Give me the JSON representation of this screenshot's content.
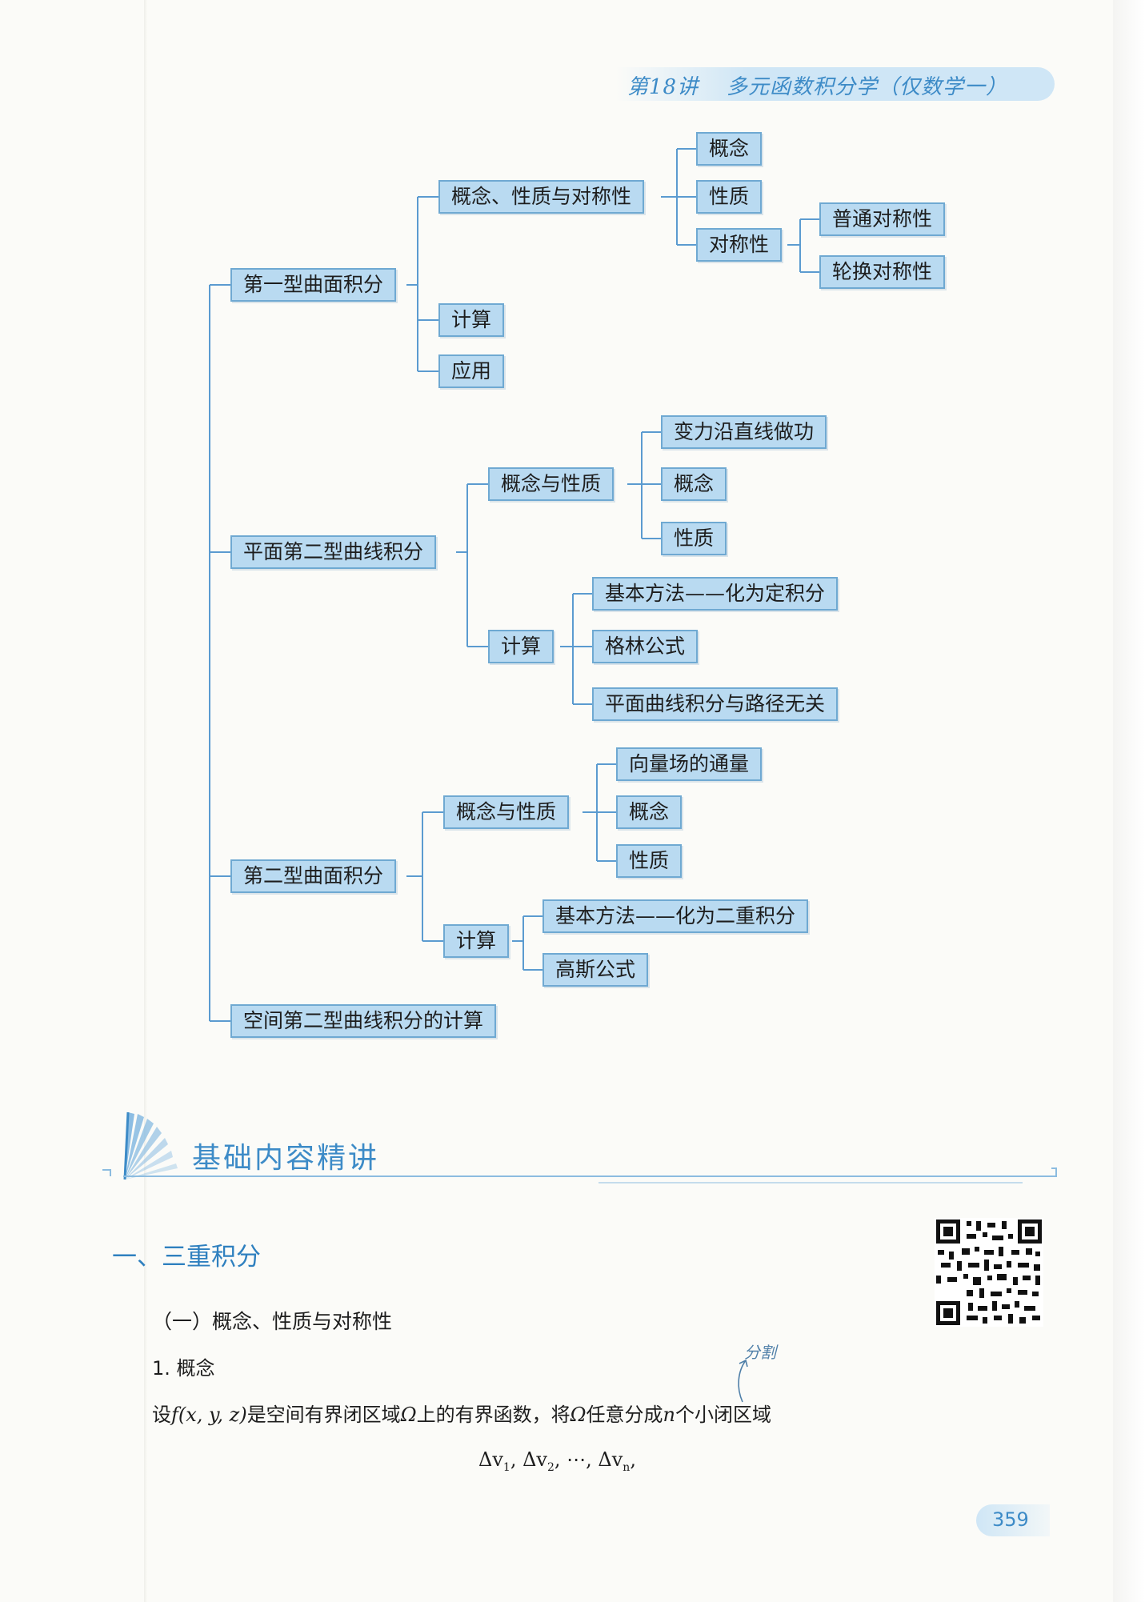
{
  "header": {
    "lecture": "第18讲",
    "title": "多元函数积分学（仅数学一）"
  },
  "mindmap": {
    "b1": {
      "label": "第一型曲面积分",
      "c1": {
        "label": "概念、性质与对称性",
        "g1": "概念",
        "g2": "性质",
        "g3": {
          "label": "对称性",
          "h1": "普通对称性",
          "h2": "轮换对称性"
        }
      },
      "c2": "计算",
      "c3": "应用"
    },
    "b2": {
      "label": "平面第二型曲线积分",
      "c1": {
        "label": "概念与性质",
        "g1": "变力沿直线做功",
        "g2": "概念",
        "g3": "性质"
      },
      "c2": {
        "label": "计算",
        "g1": "基本方法——化为定积分",
        "g2": "格林公式",
        "g3": "平面曲线积分与路径无关"
      }
    },
    "b3": {
      "label": "第二型曲面积分",
      "c1": {
        "label": "概念与性质",
        "g1": "向量场的通量",
        "g2": "概念",
        "g3": "性质"
      },
      "c2": {
        "label": "计算",
        "g1": "基本方法——化为二重积分",
        "g2": "高斯公式"
      }
    },
    "b4": "空间第二型曲线积分的计算"
  },
  "banner": {
    "title": "基础内容精讲"
  },
  "section": {
    "heading": "一、三重积分",
    "subheading": "（一）概念、性质与对称性",
    "item": "1. 概念",
    "annotation": "分割",
    "text_part1": "设",
    "text_func": "f(x, y, z)",
    "text_part2": "是空间有界闭区域",
    "text_omega1": "Ω",
    "text_part3": "上的有界函数，将",
    "text_omega2": "Ω",
    "text_part4": "任意分成",
    "text_n": "n",
    "text_part5": "个小闭区域",
    "formula": {
      "d1": "Δv",
      "s1": "1",
      "sep1": ", ",
      "d2": "Δv",
      "s2": "2",
      "sep2": ", ⋯, ",
      "d3": "Δv",
      "s3": "n",
      "end": ","
    }
  },
  "page_number": "359",
  "colors": {
    "accent": "#3d8bc7",
    "node_fill": "#b9daf1",
    "node_border": "#6fa9d2",
    "connector": "#5b9bd0"
  }
}
